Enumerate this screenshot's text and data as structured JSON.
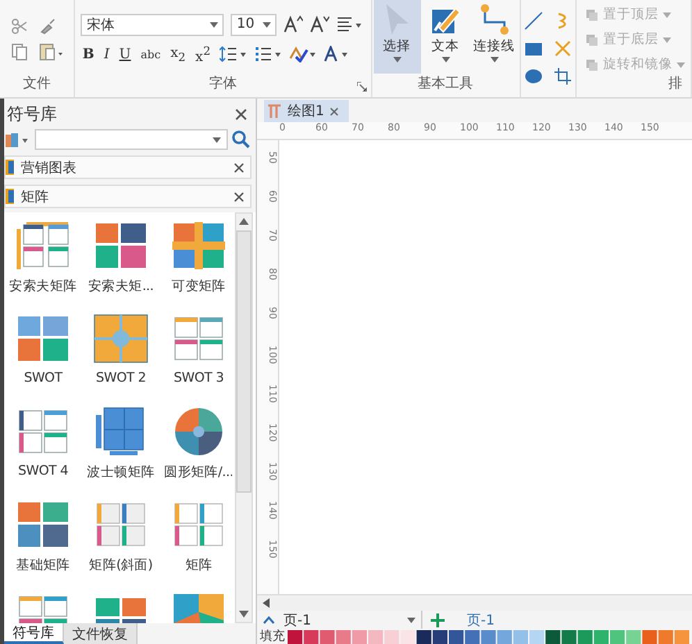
{
  "ribbon": {
    "file_group": {
      "label": "文件"
    },
    "font_group": {
      "font": "宋体",
      "size": "10",
      "format_buttons": [
        "B",
        "I",
        "U",
        "abc",
        "x$_{2}$",
        "x$^{2}$"
      ],
      "label": "字体"
    },
    "tools_group": {
      "tools": [
        {
          "label": "选择",
          "selected": true
        },
        {
          "label": "文本",
          "selected": false
        },
        {
          "label": "连接线",
          "selected": false
        }
      ],
      "label": "基本工具"
    },
    "arrange_group": {
      "items": [
        "置于顶层",
        "置于底层",
        "旋转和镜像"
      ],
      "label": "排"
    }
  },
  "library_panel": {
    "title": "符号库",
    "categories": [
      {
        "name": "营销图表"
      },
      {
        "name": "矩阵"
      }
    ],
    "shapes": [
      {
        "label": "安索夫矩阵"
      },
      {
        "label": "安索夫矩..."
      },
      {
        "label": "可变矩阵"
      },
      {
        "label": "SWOT"
      },
      {
        "label": "SWOT 2"
      },
      {
        "label": "SWOT 3"
      },
      {
        "label": "SWOT 4"
      },
      {
        "label": "波士顿矩阵"
      },
      {
        "label": "圆形矩阵/..."
      },
      {
        "label": "基础矩阵"
      },
      {
        "label": "矩阵(斜面)"
      },
      {
        "label": "矩阵"
      }
    ]
  },
  "bottom_tabs": [
    {
      "label": "符号库",
      "selected": true
    },
    {
      "label": "文件恢复",
      "selected": false
    }
  ],
  "document_tabs": [
    {
      "title": "绘图1",
      "selected": true
    }
  ],
  "ruler": {
    "horizontal": [
      "0",
      "60",
      "70",
      "80",
      "90",
      "100",
      "110",
      "120",
      "130",
      "140",
      "150"
    ],
    "vertical": [
      "50",
      "60",
      "70",
      "80",
      "90",
      "100",
      "110",
      "120",
      "130",
      "140",
      "150"
    ]
  },
  "page_bar": {
    "page_select": "页-1",
    "page_tab": "页-1"
  },
  "fill_bar": {
    "label": "填充"
  }
}
